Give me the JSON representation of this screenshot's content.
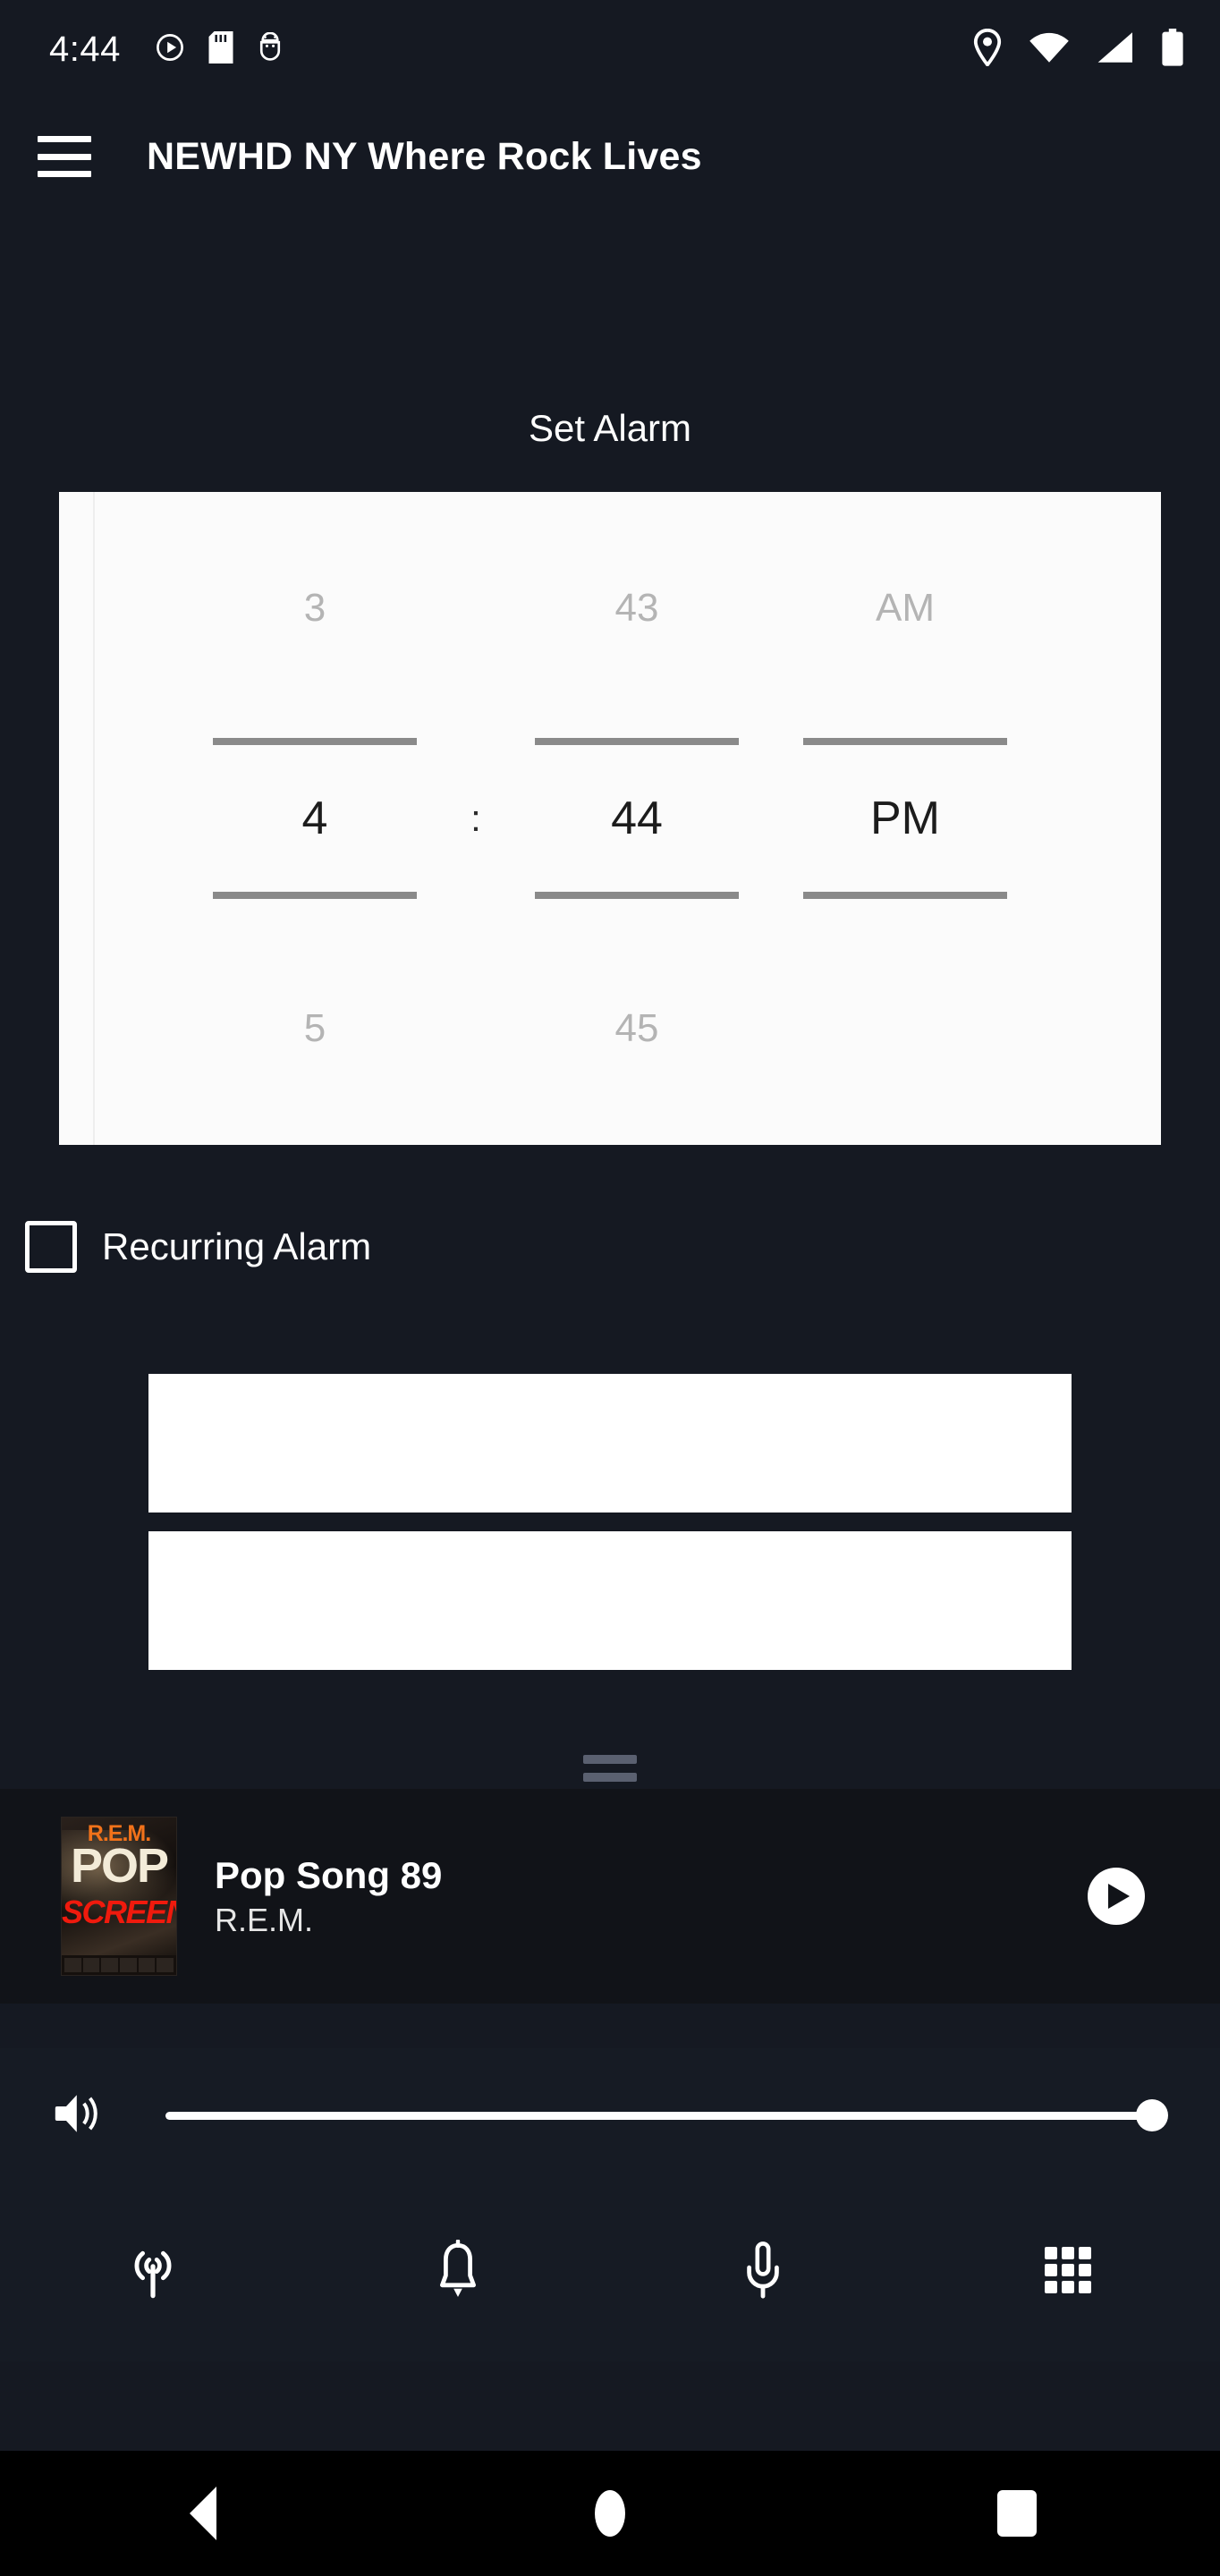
{
  "statusbar": {
    "clock": "4:44",
    "left_icons": [
      "play-circle-icon",
      "sd-card-icon",
      "android-debug-icon"
    ],
    "right_icons": [
      "location-pin-icon",
      "wifi-icon",
      "cellular-signal-icon",
      "battery-icon"
    ]
  },
  "appbar": {
    "menu_icon": "hamburger-menu-icon",
    "title": "NEWHD NY Where Rock Lives"
  },
  "main": {
    "section_title": "Set Alarm",
    "time_picker": {
      "hour": {
        "previous": "3",
        "selected": "4",
        "next": "5"
      },
      "separator": ":",
      "minute": {
        "previous": "43",
        "selected": "44",
        "next": "45"
      },
      "meridiem": {
        "previous": "AM",
        "selected": "PM",
        "next": ""
      }
    },
    "recurring": {
      "label": "Recurring Alarm",
      "checked": false
    },
    "blocks": [
      {
        "name": "white-block-1",
        "text": ""
      },
      {
        "name": "white-block-2",
        "text": ""
      }
    ],
    "drag_handle": "drag-handle-icon"
  },
  "nowplaying": {
    "album_art": {
      "line1": "R.E.M.",
      "line2": "POP",
      "line3": "SCREEN",
      "colors": {
        "line1": "#f2721a",
        "line2": "#f3ebd8",
        "line3": "#f01a0d"
      }
    },
    "title": "Pop Song 89",
    "artist": "R.E.M.",
    "play_icon": "play-icon"
  },
  "volume": {
    "icon": "speaker-volume-icon",
    "level": 100
  },
  "tabbar": {
    "items": [
      {
        "name": "tab-radio",
        "icon": "broadcast-antenna-icon"
      },
      {
        "name": "tab-alarm",
        "icon": "bell-icon"
      },
      {
        "name": "tab-podcast",
        "icon": "microphone-icon"
      },
      {
        "name": "tab-more",
        "icon": "grid-icon"
      }
    ]
  },
  "navbar": {
    "back": "back-triangle-icon",
    "home": "home-circle-icon",
    "recents": "recents-square-icon"
  },
  "colors": {
    "background": "#151922",
    "player_bg": "#111318",
    "bar_bg": "#161b24",
    "card_bg": "#fbfbfb",
    "accent_white": "#ffffff"
  }
}
